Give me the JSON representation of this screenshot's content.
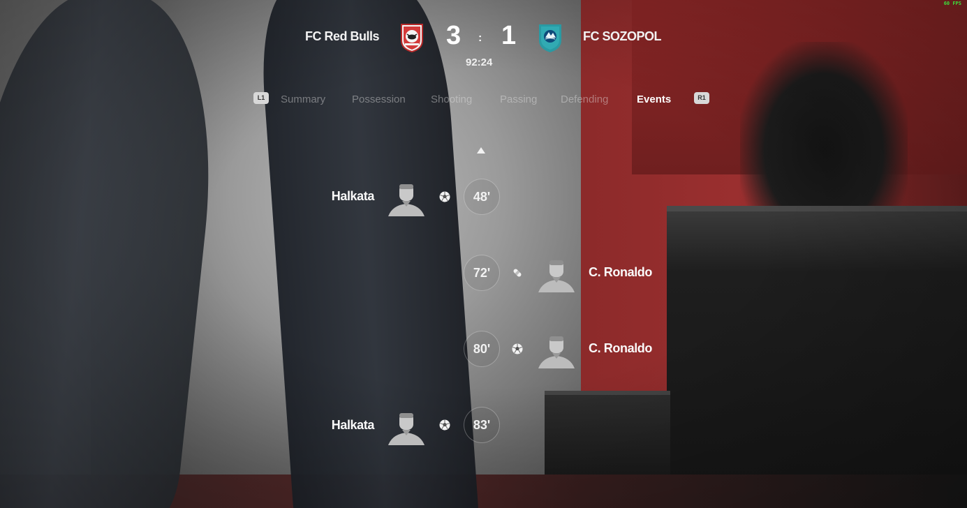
{
  "hud": {
    "fps": "60 FPS"
  },
  "match": {
    "home": {
      "name": "FC Red Bulls",
      "score": "3",
      "crest_icon": "red-bulls-crest-icon",
      "crest_color": "#d33a3a"
    },
    "away": {
      "name": "FC SOZOPOL",
      "score": "1",
      "crest_icon": "sozopol-crest-icon",
      "crest_color": "#2a9aa3"
    },
    "separator": ":",
    "clock": "92:24"
  },
  "tabs": {
    "prev_button": "L1",
    "next_button": "R1",
    "items": [
      {
        "label": "Summary",
        "active": false
      },
      {
        "label": "Possession",
        "active": false
      },
      {
        "label": "Shooting",
        "active": false
      },
      {
        "label": "Passing",
        "active": false
      },
      {
        "label": "Defending",
        "active": false
      },
      {
        "label": "Events",
        "active": true
      }
    ]
  },
  "events": [
    {
      "side": "home",
      "player": "Halkata",
      "minute": "48'",
      "type": "goal",
      "icon": "ball-icon"
    },
    {
      "side": "away",
      "player": "C. Ronaldo",
      "minute": "72'",
      "type": "injury",
      "icon": "bandage-icon"
    },
    {
      "side": "away",
      "player": "C. Ronaldo",
      "minute": "80'",
      "type": "goal",
      "icon": "ball-icon"
    },
    {
      "side": "home",
      "player": "Halkata",
      "minute": "83'",
      "type": "goal",
      "icon": "ball-icon"
    }
  ]
}
